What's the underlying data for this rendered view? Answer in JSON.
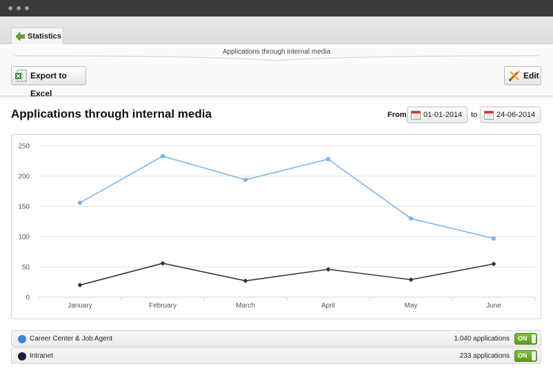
{
  "tabs": [
    {
      "label": "Statistics"
    }
  ],
  "toolbar": {
    "subtitle": "Applications through internal media",
    "export_label": "Export to Excel",
    "edit_label": "Edit"
  },
  "page": {
    "title": "Applications through internal media"
  },
  "date_range": {
    "from_label": "From",
    "from_value": "01-01-2014",
    "to_label": "to",
    "to_value": "24-06-2014"
  },
  "legend": [
    {
      "name": "Career Center & Job Agent",
      "count": "1.040 applications",
      "toggle": "ON",
      "color": "#3b86d8"
    },
    {
      "name": "Intranet",
      "count": "233 applications",
      "toggle": "ON",
      "color": "#1a2233"
    }
  ],
  "chart_data": {
    "type": "line",
    "categories": [
      "January",
      "February",
      "March",
      "April",
      "May",
      "June"
    ],
    "yticks": [
      "0",
      "50",
      "100",
      "150",
      "200",
      "250"
    ],
    "ylim": [
      0,
      250
    ],
    "grid": true,
    "series": [
      {
        "values": [
          156,
          233,
          194,
          228,
          130,
          97
        ],
        "color": "#7db5e8",
        "marker": "circle"
      },
      {
        "values": [
          20,
          56,
          27,
          46,
          29,
          55
        ],
        "color": "#333333",
        "marker": "diamond"
      }
    ]
  }
}
